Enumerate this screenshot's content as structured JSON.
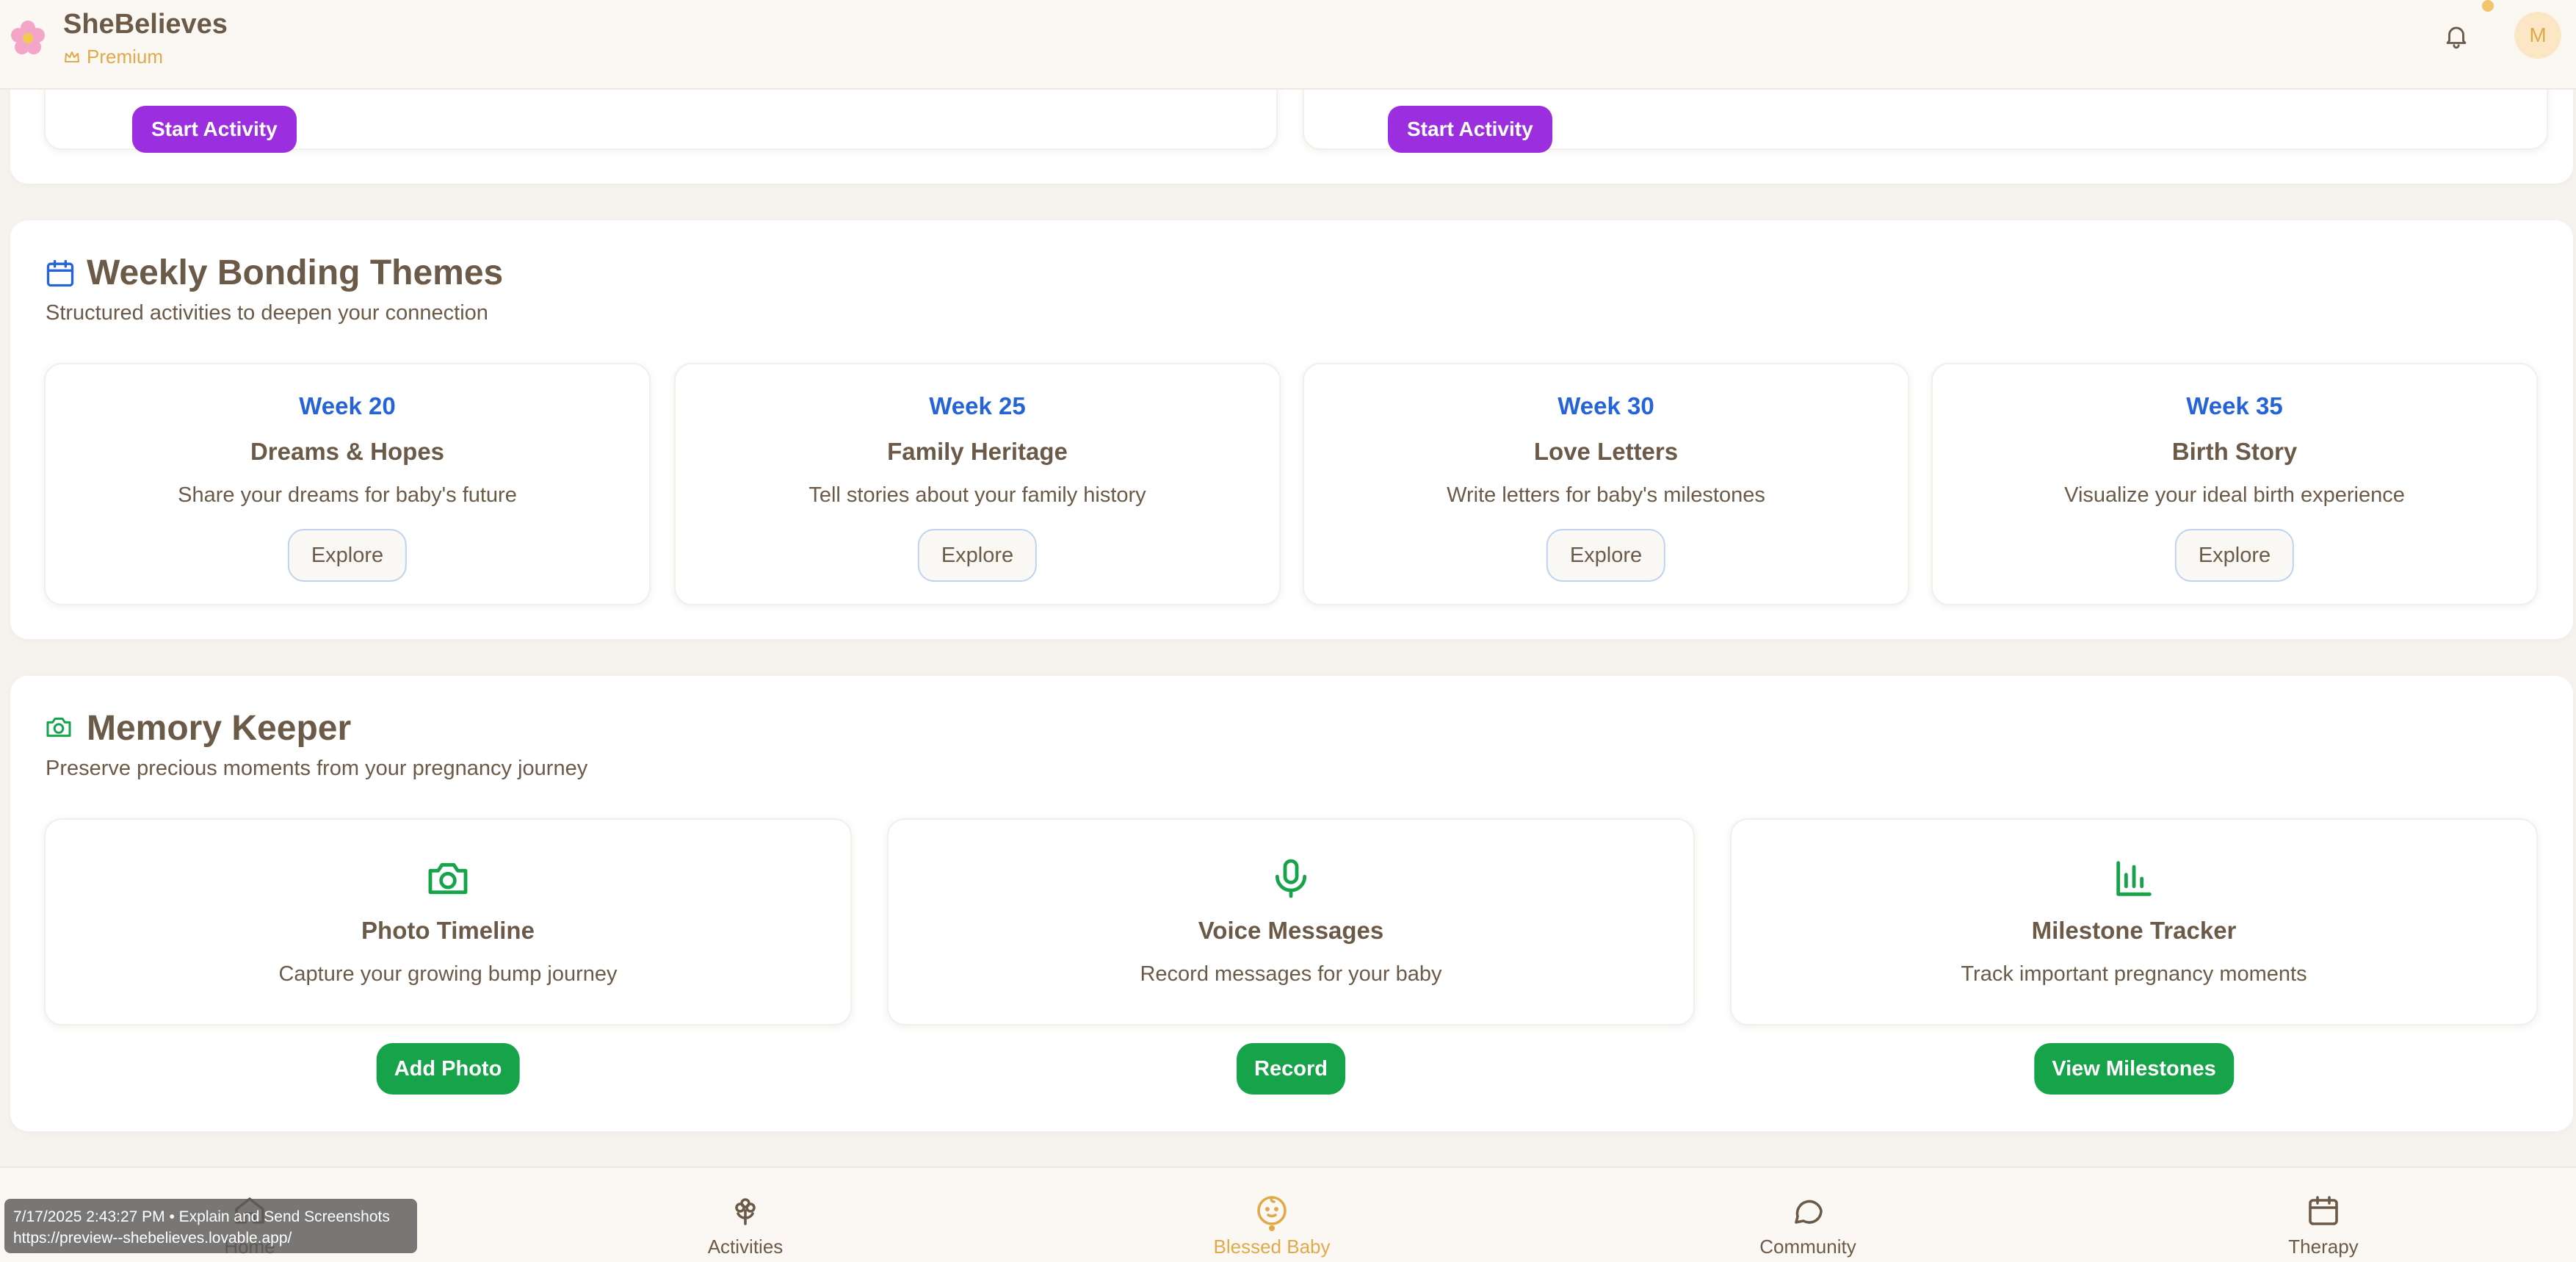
{
  "header": {
    "brand": "SheBelieves",
    "badge": "Premium",
    "avatar_initial": "M"
  },
  "top_panel": {
    "buttons": [
      "Start Activity",
      "Start Activity"
    ]
  },
  "weekly": {
    "title": "Weekly Bonding Themes",
    "subtitle": "Structured activities to deepen your connection",
    "cards": [
      {
        "week": "Week 20",
        "title": "Dreams & Hopes",
        "desc": "Share your dreams for baby's future",
        "button": "Explore"
      },
      {
        "week": "Week 25",
        "title": "Family Heritage",
        "desc": "Tell stories about your family history",
        "button": "Explore"
      },
      {
        "week": "Week 30",
        "title": "Love Letters",
        "desc": "Write letters for baby's milestones",
        "button": "Explore"
      },
      {
        "week": "Week 35",
        "title": "Birth Story",
        "desc": "Visualize your ideal birth experience",
        "button": "Explore"
      }
    ]
  },
  "memory": {
    "title": "Memory Keeper",
    "subtitle": "Preserve precious moments from your pregnancy journey",
    "cards": [
      {
        "icon": "camera-icon",
        "title": "Photo Timeline",
        "desc": "Capture your growing bump journey",
        "button": "Add Photo"
      },
      {
        "icon": "microphone-icon",
        "title": "Voice Messages",
        "desc": "Record messages for your baby",
        "button": "Record"
      },
      {
        "icon": "bar-chart-icon",
        "title": "Milestone Tracker",
        "desc": "Track important pregnancy moments",
        "button": "View Milestones"
      }
    ]
  },
  "nav": {
    "items": [
      {
        "label": "Home",
        "icon": "home-icon"
      },
      {
        "label": "Activities",
        "icon": "flower-icon"
      },
      {
        "label": "Blessed Baby",
        "icon": "baby-icon",
        "active": true
      },
      {
        "label": "Community",
        "icon": "chat-bubble-icon"
      },
      {
        "label": "Therapy",
        "icon": "calendar-icon"
      }
    ]
  },
  "overlay": {
    "line1": "7/17/2025 2:43:27 PM • Explain and Send Screenshots",
    "line2": "https://preview--shebelieves.lovable.app/"
  },
  "colors": {
    "accent_gold": "#e0a94a",
    "text_brown": "#6b5a48",
    "week_blue": "#2663d8",
    "memory_green": "#17a34a",
    "activity_purple": "#9b2fe0"
  }
}
